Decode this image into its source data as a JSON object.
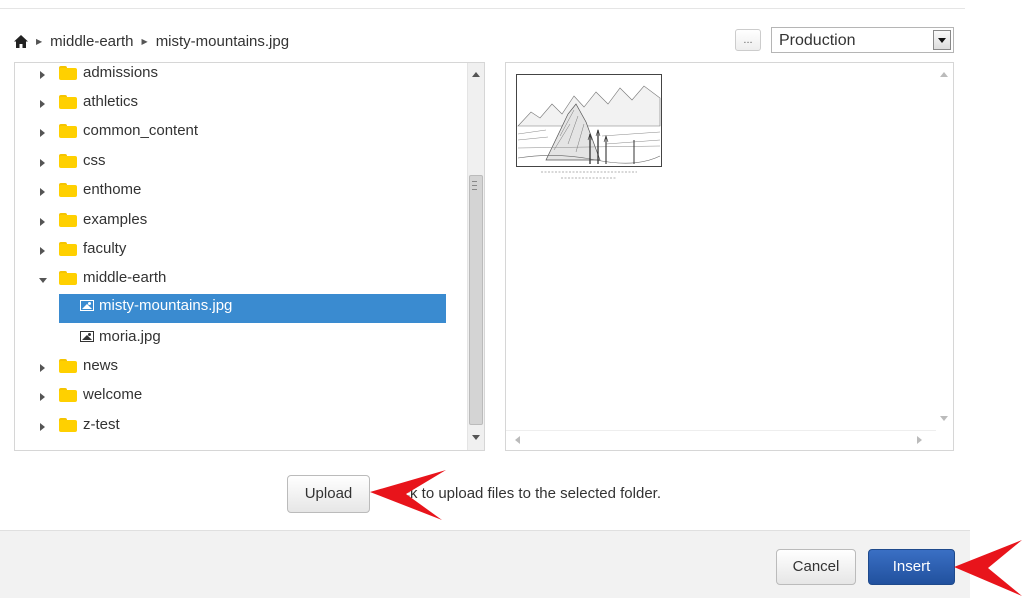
{
  "breadcrumb": {
    "home_icon": "home-icon",
    "items": [
      "middle-earth",
      "misty-mountains.jpg"
    ]
  },
  "environment": {
    "more_label": "...",
    "selected": "Production"
  },
  "tree": {
    "items": [
      {
        "label": "admissions",
        "type": "folder",
        "state": "collapsed"
      },
      {
        "label": "athletics",
        "type": "folder",
        "state": "collapsed"
      },
      {
        "label": "common_content",
        "type": "folder",
        "state": "collapsed"
      },
      {
        "label": "css",
        "type": "folder",
        "state": "collapsed"
      },
      {
        "label": "enthome",
        "type": "folder",
        "state": "collapsed"
      },
      {
        "label": "examples",
        "type": "folder",
        "state": "collapsed"
      },
      {
        "label": "faculty",
        "type": "folder",
        "state": "collapsed"
      },
      {
        "label": "middle-earth",
        "type": "folder",
        "state": "expanded"
      },
      {
        "label": "misty-mountains.jpg",
        "type": "image",
        "selected": true
      },
      {
        "label": "moria.jpg",
        "type": "image"
      },
      {
        "label": "news",
        "type": "folder",
        "state": "collapsed"
      },
      {
        "label": "welcome",
        "type": "folder",
        "state": "collapsed"
      },
      {
        "label": "z-test",
        "type": "folder",
        "state": "collapsed"
      }
    ],
    "selection_color": "#3a8bd0",
    "folder_color": "#ffd000"
  },
  "preview": {
    "image_icon": "mountain-engraving-thumbnail"
  },
  "upload": {
    "button_label": "Upload",
    "hint": "Click to upload files to the selected folder."
  },
  "footer": {
    "cancel_label": "Cancel",
    "insert_label": "Insert",
    "insert_color": "#2a5db0"
  },
  "annotations": {
    "arrow_color": "#e8141b"
  }
}
